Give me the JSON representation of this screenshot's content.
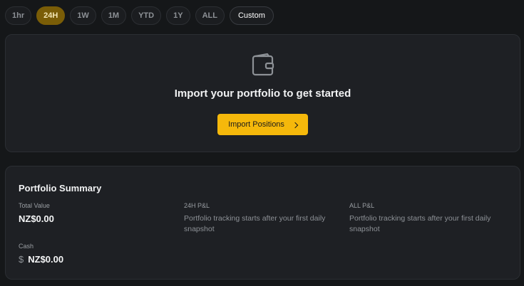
{
  "range_options": [
    {
      "label": "1hr",
      "active": false
    },
    {
      "label": "24H",
      "active": true
    },
    {
      "label": "1W",
      "active": false
    },
    {
      "label": "1M",
      "active": false
    },
    {
      "label": "YTD",
      "active": false
    },
    {
      "label": "1Y",
      "active": false
    },
    {
      "label": "ALL",
      "active": false
    },
    {
      "label": "Custom",
      "active": false
    }
  ],
  "import": {
    "icon": "wallet-icon",
    "title": "Import your portfolio to get started",
    "button_label": "Import Positions"
  },
  "summary": {
    "title": "Portfolio Summary",
    "total_value": {
      "label": "Total Value",
      "value": "NZ$0.00"
    },
    "pnl_24h": {
      "label": "24H P&L",
      "description": "Portfolio tracking starts after your first daily snapshot"
    },
    "pnl_all": {
      "label": "ALL P&L",
      "description": "Portfolio tracking starts after your first daily snapshot"
    },
    "cash": {
      "label": "Cash",
      "value": "NZ$0.00",
      "icon": "dollar-icon"
    }
  },
  "colors": {
    "accent": "#f5b80b",
    "active_pill": "#7a5d07",
    "background": "#151719",
    "card": "#1e2024"
  }
}
